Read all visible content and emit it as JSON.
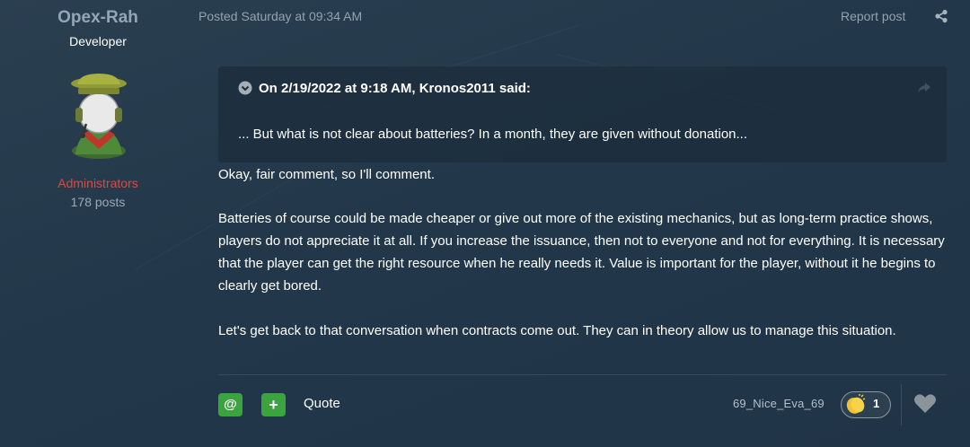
{
  "author": {
    "name": "Opex-Rah",
    "title": "Developer",
    "group": "Administrators",
    "posts": "178 posts"
  },
  "post": {
    "date": "Posted Saturday at 09:34 AM",
    "report_label": "Report post"
  },
  "quote": {
    "citation": "On 2/19/2022 at 9:18 AM, Kronos2011 said:",
    "text": "... But what is not clear about batteries? In a month, they are given without donation..."
  },
  "body": {
    "p1": "Okay, fair comment, so I'll comment.",
    "p2": "Batteries of course could be made cheaper or give out more of the existing mechanics, but as long-term practice shows, players do not appreciate it at all. If you increase the issuance, then not to everyone and not for everything. It is necessary that the player can get the right resource when he really needs it. Value is important for the player, without it he begins to clearly get bored.",
    "p3": "Let's get back to that conversation when contracts come out. They can in theory allow us to manage this situation."
  },
  "footer": {
    "mention_label": "@",
    "multiquote_label": "+",
    "quote_label": "Quote",
    "reacted_user": "69_Nice_Eva_69",
    "reaction_count": "1"
  },
  "colors": {
    "accent_green": "#3aa43f",
    "group_red": "#e0473f",
    "author_name": "#93a6b8"
  },
  "icons": {
    "share": "share-icon",
    "quote_toggle": "chevron-down-circle-icon",
    "quote_jump": "share-arrow-icon",
    "reaction": "clapping-hands-icon",
    "react": "heart-icon"
  }
}
